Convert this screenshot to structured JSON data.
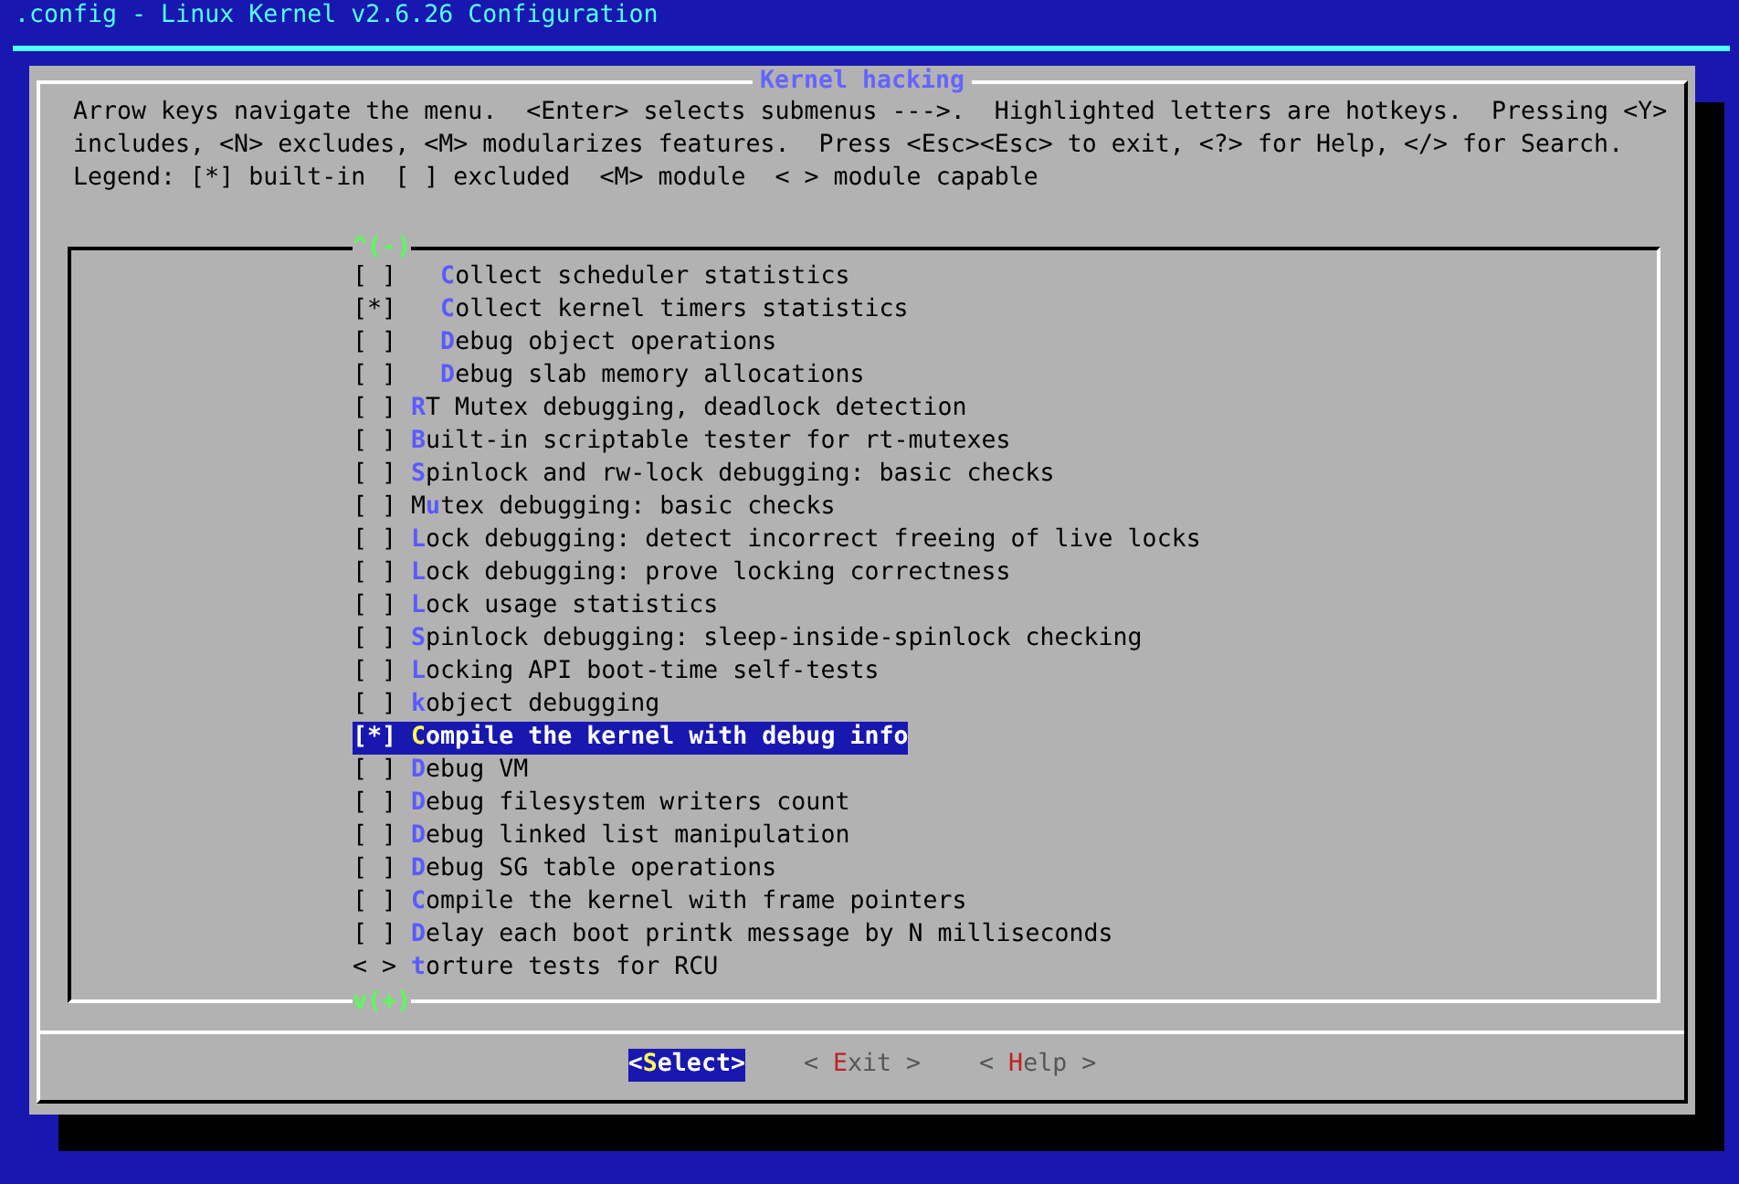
{
  "window": {
    "title": ".config - Linux Kernel v2.6.26 Configuration"
  },
  "dialog": {
    "title": "Kernel hacking",
    "help_lines": [
      "Arrow keys navigate the menu.  <Enter> selects submenus --->.  Highlighted letters are hotkeys.  Pressing <Y>",
      "includes, <N> excludes, <M> modularizes features.  Press <Esc><Esc> to exit, <?> for Help, </> for Search.",
      "Legend: [*] built-in  [ ] excluded  <M> module  < > module capable"
    ],
    "scroll_up": "^(-)",
    "scroll_down": "v(+)",
    "items": [
      {
        "checkbox": "[ ]",
        "indented": true,
        "label": "**C**ollect scheduler statistics",
        "selected": false
      },
      {
        "checkbox": "[*]",
        "indented": true,
        "label": "**C**ollect kernel timers statistics",
        "selected": false
      },
      {
        "checkbox": "[ ]",
        "indented": true,
        "label": "**D**ebug object operations",
        "selected": false
      },
      {
        "checkbox": "[ ]",
        "indented": true,
        "label": "**D**ebug slab memory allocations",
        "selected": false
      },
      {
        "checkbox": "[ ]",
        "indented": false,
        "label": "**R**T Mutex debugging, deadlock detection",
        "selected": false
      },
      {
        "checkbox": "[ ]",
        "indented": false,
        "label": "**B**uilt-in scriptable tester for rt-mutexes",
        "selected": false
      },
      {
        "checkbox": "[ ]",
        "indented": false,
        "label": "**S**pinlock and rw-lock debugging: basic checks",
        "selected": false
      },
      {
        "checkbox": "[ ]",
        "indented": false,
        "label": "M**u**tex debugging: basic checks",
        "selected": false
      },
      {
        "checkbox": "[ ]",
        "indented": false,
        "label": "**L**ock debugging: detect incorrect freeing of live locks",
        "selected": false
      },
      {
        "checkbox": "[ ]",
        "indented": false,
        "label": "**L**ock debugging: prove locking correctness",
        "selected": false
      },
      {
        "checkbox": "[ ]",
        "indented": false,
        "label": "**L**ock usage statistics",
        "selected": false
      },
      {
        "checkbox": "[ ]",
        "indented": false,
        "label": "**S**pinlock debugging: sleep-inside-spinlock checking",
        "selected": false
      },
      {
        "checkbox": "[ ]",
        "indented": false,
        "label": "**L**ocking API boot-time self-tests",
        "selected": false
      },
      {
        "checkbox": "[ ]",
        "indented": false,
        "label": "**k**object debugging",
        "selected": false
      },
      {
        "checkbox": "[*]",
        "indented": false,
        "label": "**C**ompile the kernel with debug info",
        "selected": true
      },
      {
        "checkbox": "[ ]",
        "indented": false,
        "label": "**D**ebug VM",
        "selected": false
      },
      {
        "checkbox": "[ ]",
        "indented": false,
        "label": "**D**ebug filesystem writers count",
        "selected": false
      },
      {
        "checkbox": "[ ]",
        "indented": false,
        "label": "**D**ebug linked list manipulation",
        "selected": false
      },
      {
        "checkbox": "[ ]",
        "indented": false,
        "label": "**D**ebug SG table operations",
        "selected": false
      },
      {
        "checkbox": "[ ]",
        "indented": false,
        "label": "**C**ompile the kernel with frame pointers",
        "selected": false
      },
      {
        "checkbox": "[ ]",
        "indented": false,
        "label": "**D**elay each boot printk message by N milliseconds",
        "selected": false
      },
      {
        "checkbox": "< >",
        "indented": false,
        "label": "**t**orture tests for RCU",
        "selected": false
      }
    ],
    "buttons": [
      {
        "label": "<**S**elect>",
        "selected": true
      },
      {
        "label": "< **E**xit >",
        "selected": false
      },
      {
        "label": "< **H**elp >",
        "selected": false
      }
    ]
  }
}
